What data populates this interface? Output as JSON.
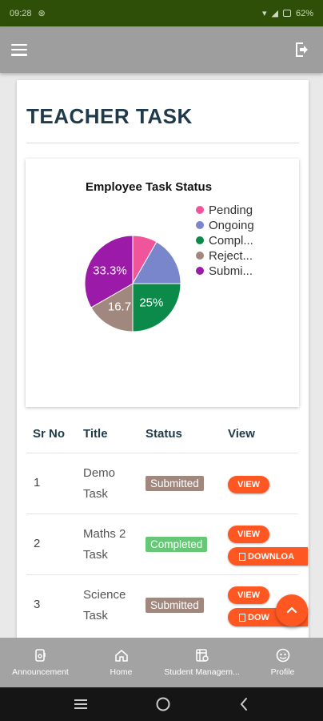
{
  "status_bar": {
    "time": "09:28",
    "battery": "62%"
  },
  "app_bar": {
    "menu_icon": "menu-icon",
    "logout_icon": "logout-icon"
  },
  "page": {
    "title": "TEACHER TASK"
  },
  "chart_data": {
    "type": "pie",
    "title": "Employee Task Status",
    "legend_position": "right",
    "legend": [
      "Pending",
      "Ongoing",
      "Compl...",
      "Reject...",
      "Submi..."
    ],
    "slice_labels": [
      "25%",
      "16.7",
      "33.3%"
    ],
    "series": [
      {
        "name": "Pending",
        "value": 8.3,
        "color": "#f0549a"
      },
      {
        "name": "Ongoing",
        "value": 16.7,
        "color": "#7986cb"
      },
      {
        "name": "Completed",
        "value": 25.0,
        "color": "#0b8a4a"
      },
      {
        "name": "Rejected",
        "value": 16.7,
        "color": "#a1887f"
      },
      {
        "name": "Submitted",
        "value": 33.3,
        "color": "#9c1aa8"
      }
    ]
  },
  "table": {
    "headers": {
      "sr": "Sr No",
      "title": "Title",
      "status": "Status",
      "view": "View"
    },
    "rows": [
      {
        "sr": "1",
        "title": "Demo Task",
        "status": "Submitted",
        "status_color": "#a1887f",
        "view": "VIEW",
        "download": ""
      },
      {
        "sr": "2",
        "title": "Maths 2 Task",
        "status": "Completed",
        "status_color": "#66c777",
        "view": "VIEW",
        "download": "DOWNLOA"
      },
      {
        "sr": "3",
        "title": "Science Task",
        "status": "Submitted",
        "status_color": "#a1887f",
        "view": "VIEW",
        "download": "DOW"
      }
    ]
  },
  "fab": {
    "icon": "chevron-up-icon"
  },
  "bottom_nav": [
    {
      "label": "Announcement",
      "icon": "announcement-icon"
    },
    {
      "label": "Home",
      "icon": "home-icon"
    },
    {
      "label": "Student Managem...",
      "icon": "student-management-icon"
    },
    {
      "label": "Profile",
      "icon": "profile-icon"
    }
  ],
  "colors": {
    "accent": "#ff5722",
    "status_bar": "#2d4f08",
    "app_bar": "#9e9e9e",
    "title": "#1f3a4a"
  }
}
